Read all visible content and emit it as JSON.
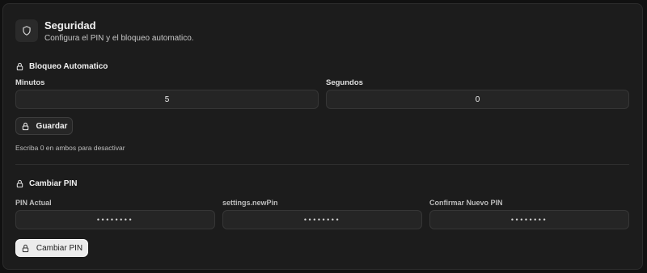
{
  "header": {
    "title": "Seguridad",
    "subtitle": "Configura el PIN y el bloqueo automatico.",
    "icon": "shield-icon"
  },
  "auto_lock": {
    "heading": "Bloqueo Automatico",
    "icon": "lock-icon",
    "minutes_label": "Minutos",
    "minutes_value": "5",
    "seconds_label": "Segundos",
    "seconds_value": "0",
    "save_label": "Guardar",
    "hint": "Escriba 0 en ambos para desactivar"
  },
  "change_pin": {
    "heading": "Cambiar PIN",
    "icon": "lock-icon",
    "current_label": "PIN Actual",
    "current_value": "••••••••",
    "new_label": "settings.newPin",
    "new_value": "••••••••",
    "confirm_label": "Confirmar Nuevo PIN",
    "confirm_value": "••••••••",
    "button_label": "Cambiar PIN"
  },
  "colors": {
    "background": "#111111",
    "card": "#1c1c1c",
    "field": "#252525",
    "primary_button": "#ececec"
  }
}
